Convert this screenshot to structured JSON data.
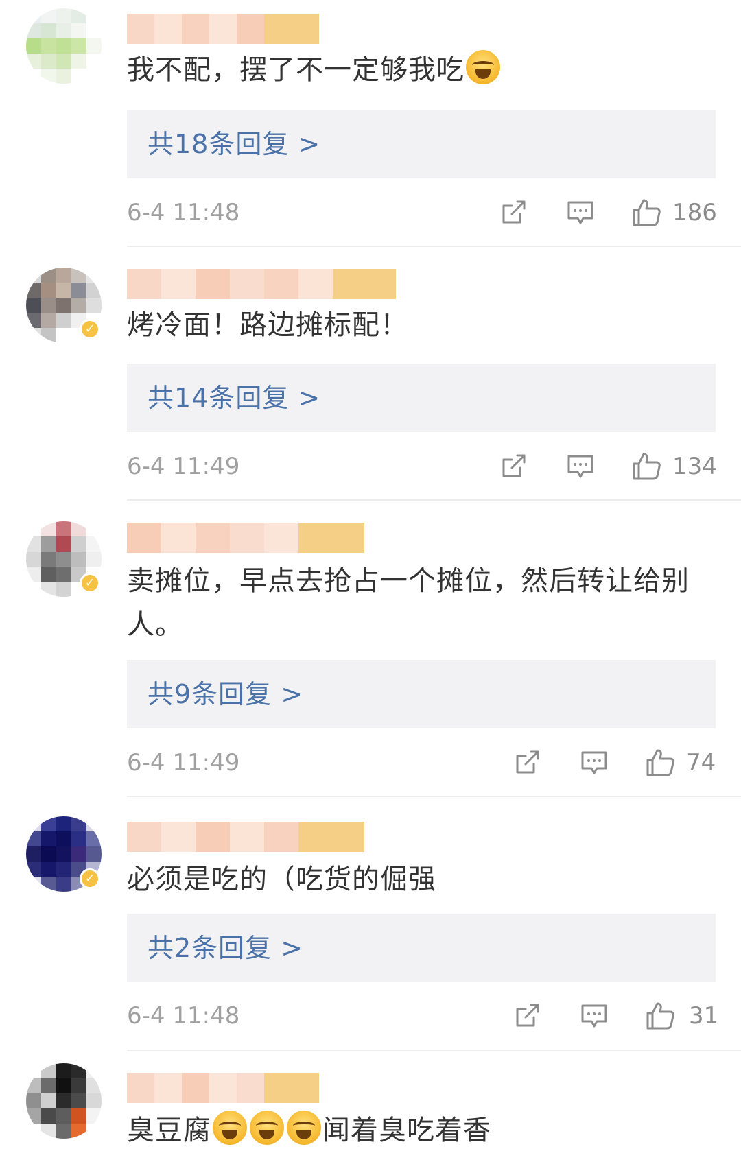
{
  "comments": [
    {
      "text": "我不配，摆了不一定够我吃",
      "emoji_after": 1,
      "reply_label": "共18条回复 >",
      "time": "6-4 11:48",
      "likes": "186",
      "verified": false,
      "avatar_colors": [
        "#e9eef0",
        "#f1f4f2",
        "#eef2ec",
        "#e4ece6",
        "#ffffff",
        "#dfe8e0",
        "#d6e6d2",
        "#e8efe6",
        "#f3f6f1",
        "#ffffff",
        "#b8dd8a",
        "#c7e39f",
        "#bfe095",
        "#cbe6a6",
        "#f4f7f0",
        "#e6f0db",
        "#dbeac8",
        "#d0e6b4",
        "#eef4e6",
        "#ffffff",
        "#ffffff",
        "#f2f7ec",
        "#eaf2df",
        "#ffffff",
        "#ffffff"
      ]
    },
    {
      "text": "烤冷面！路边摊标配！",
      "emoji_after": 0,
      "reply_label": "共14条回复 >",
      "time": "6-4 11:49",
      "likes": "134",
      "verified": true,
      "avatar_colors": [
        "#d8d8d8",
        "#9b8f86",
        "#b8a79a",
        "#c9c2bc",
        "#e6e6e6",
        "#6f6a6a",
        "#a58f80",
        "#c6b6a8",
        "#8a8d95",
        "#d2d2d2",
        "#4e4e56",
        "#9a8f88",
        "#7d726d",
        "#b3aca7",
        "#dedede",
        "#6a6a70",
        "#b5aaa3",
        "#cfcfcf",
        "#f0f0f0",
        "#ffffff",
        "#e0e0e0",
        "#c4c4c4",
        "#ffffff",
        "#ffffff",
        "#ffffff"
      ]
    },
    {
      "text": "卖摊位，早点去抢占一个摊位，然后转让给别人。",
      "emoji_after": 0,
      "reply_label": "共9条回复 >",
      "time": "6-4 11:49",
      "likes": "74",
      "verified": true,
      "avatar_colors": [
        "#ffffff",
        "#f3e2e2",
        "#c9737a",
        "#f0dada",
        "#ffffff",
        "#e2e2e2",
        "#9d9d9d",
        "#b04a52",
        "#cfcfcf",
        "#f4f4f4",
        "#d7d7d7",
        "#7a7a7a",
        "#8e8e8e",
        "#bdbdbd",
        "#efefef",
        "#ededed",
        "#5f5f5f",
        "#6e6e6e",
        "#c9c9c9",
        "#ffffff",
        "#ffffff",
        "#e4e4e4",
        "#d3d3d3",
        "#ffffff",
        "#ffffff"
      ]
    },
    {
      "text": "必须是吃的（吃货的倔强",
      "emoji_after": 0,
      "reply_label": "共2条回复 >",
      "time": "6-4 11:48",
      "likes": "31",
      "verified": true,
      "avatar_colors": [
        "#dcdcf0",
        "#3b3f95",
        "#1d227a",
        "#3a3d8c",
        "#d8d8ea",
        "#43478f",
        "#15176a",
        "#0e0f5c",
        "#2a2e85",
        "#6a6ea8",
        "#1e1f63",
        "#0a0b52",
        "#12125e",
        "#3b2a7a",
        "#56598f",
        "#2c2d78",
        "#16166a",
        "#222476",
        "#4a4d8a",
        "#b5b6d2",
        "#e2e2ee",
        "#575a93",
        "#3a3c86",
        "#8b8cb6",
        "#ffffff"
      ]
    },
    {
      "text_before": "臭豆腐",
      "emoji_count": 3,
      "text_after": "闻着臭吃着香",
      "verified": false,
      "avatar_colors": [
        "#ffffff",
        "#c9c9c9",
        "#1c1c1c",
        "#2a2a2a",
        "#f0f0f0",
        "#bdbdbd",
        "#6b6b6b",
        "#111111",
        "#3a3a3a",
        "#e0e0e0",
        "#8f8f8f",
        "#cfcfcf",
        "#2b2b2b",
        "#4b4b4b",
        "#d8d8d8",
        "#a5a5a5",
        "#4a4a4a",
        "#5d5d5d",
        "#d0541f",
        "#f3f3f3",
        "#ffffff",
        "#e5e5e5",
        "#6a6a6a",
        "#e56a2e",
        "#ffffff"
      ]
    }
  ],
  "colors": {
    "reply_link": "#4a72a8",
    "reply_bg": "#f2f2f4",
    "meta_text": "#a0a0a0",
    "verified_badge": "#f6c244"
  },
  "icons": [
    "share-icon",
    "comment-icon",
    "like-icon"
  ]
}
